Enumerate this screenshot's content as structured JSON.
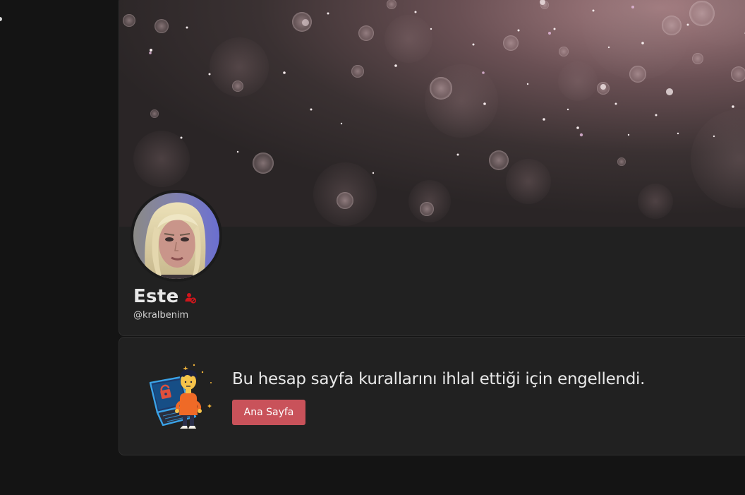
{
  "profile": {
    "display_name": "Este",
    "username": "@kralbenim",
    "banned_icon": "user-ban-icon",
    "banned_icon_color": "#d0161c"
  },
  "ban_notice": {
    "message": "Bu hesap sayfa kurallarını ihlal ettiği için engellendi.",
    "home_button_label": "Ana Sayfa",
    "home_button_color": "#c9525a",
    "illustration": "locked-laptop-illustration"
  },
  "colors": {
    "page_background": "#141414",
    "card_background": "#212121",
    "text_primary": "#e8e8e8"
  }
}
